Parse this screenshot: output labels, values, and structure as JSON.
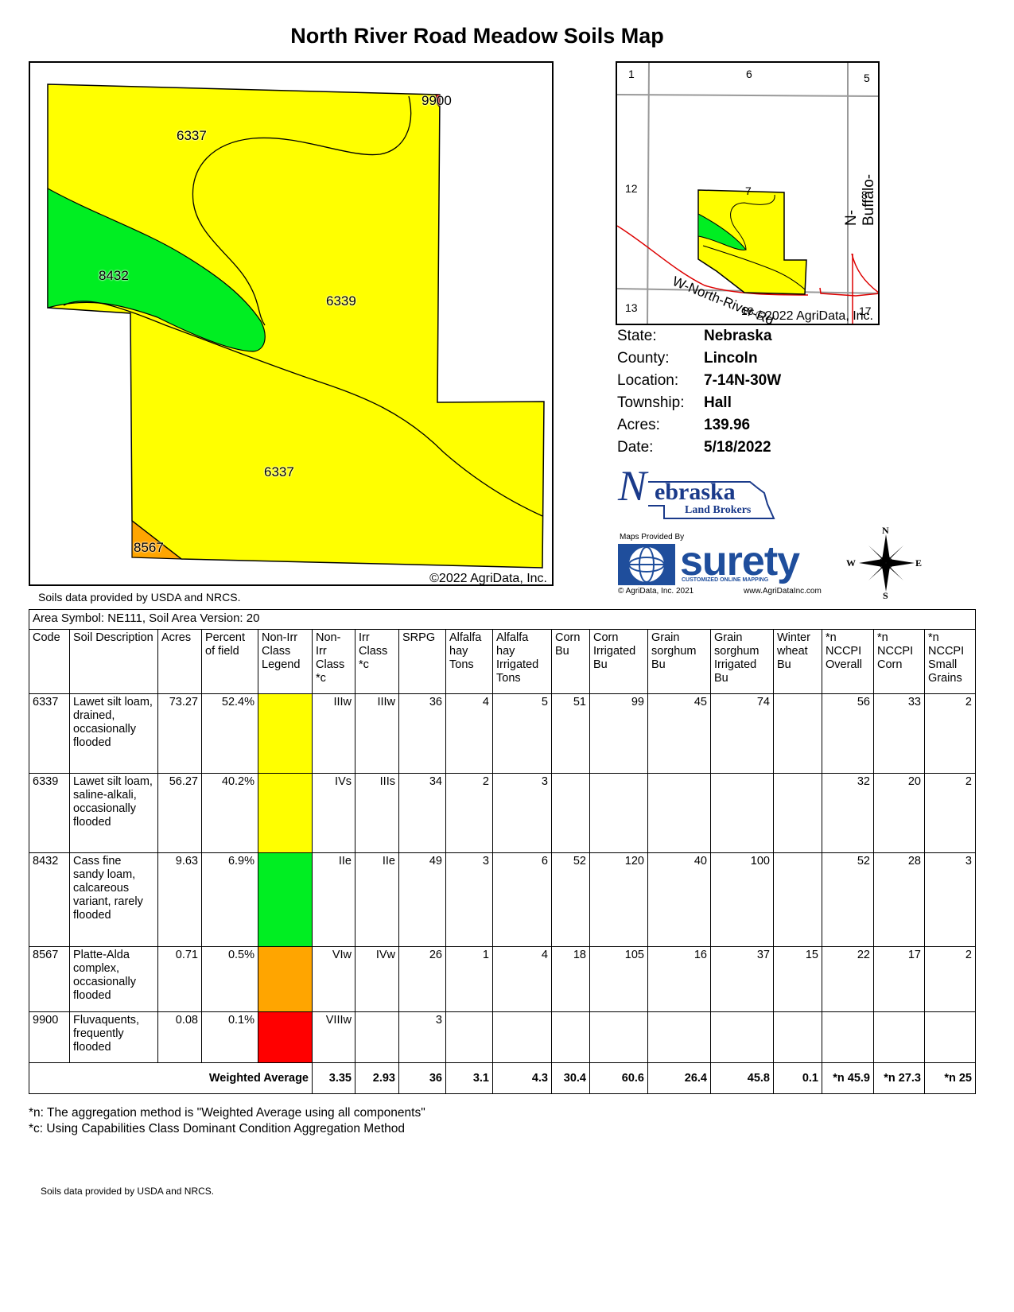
{
  "title": "North River Road Meadow Soils Map",
  "main_map": {
    "labels": [
      "6337",
      "9900",
      "8432",
      "6339",
      "6337",
      "8567"
    ],
    "copyright": "©2022 AgriData, Inc.",
    "colors": {
      "yellow": "#ffff00",
      "green": "#00ee22",
      "orange": "#ffa500"
    }
  },
  "attribution_top": "Soils data provided by USDA and NRCS.",
  "locator_map": {
    "sections": [
      "1",
      "6",
      "5",
      "12",
      "7",
      "8",
      "13",
      "18",
      "17"
    ],
    "roads": [
      "N-Buffalo-Rd",
      "W-North-River-Rd"
    ],
    "copyright": "©2022 AgriData, Inc."
  },
  "info": [
    {
      "label": "State:",
      "value": "Nebraska"
    },
    {
      "label": "County:",
      "value": "Lincoln"
    },
    {
      "label": "Location:",
      "value": "7-14N-30W"
    },
    {
      "label": "Township:",
      "value": "Hall"
    },
    {
      "label": "Acres:",
      "value": "139.96"
    },
    {
      "label": "Date:",
      "value": "5/18/2022"
    }
  ],
  "logos": {
    "nlb_main": "ebraska",
    "nlb_initial": "N",
    "nlb_sub": "Land Brokers",
    "surety_top": "Maps Provided By",
    "surety_name": "surety",
    "surety_tag": "CUSTOMIZED ONLINE MAPPING",
    "surety_copy": "© AgriData, Inc. 2021",
    "surety_url": "www.AgriDataInc.com",
    "compass": {
      "n": "N",
      "s": "S",
      "e": "E",
      "w": "W"
    }
  },
  "table": {
    "area": "Area Symbol: NE111, Soil Area Version: 20",
    "headers": [
      "Code",
      "Soil Description",
      "Acres",
      "Percent of field",
      "Non-Irr Class Legend",
      "Non-Irr Class *c",
      "Irr Class *c",
      "SRPG",
      "Alfalfa hay Tons",
      "Alfalfa hay Irrigated Tons",
      "Corn Bu",
      "Corn Irrigated Bu",
      "Grain sorghum Bu",
      "Grain sorghum Irrigated Bu",
      "Winter wheat Bu",
      "*n NCCPI Overall",
      "*n NCCPI Corn",
      "*n NCCPI Small Grains"
    ],
    "rows": [
      {
        "code": "6337",
        "desc": "Lawet silt loam, drained, occasionally flooded",
        "acres": "73.27",
        "pct": "52.4%",
        "color": "#ffff00",
        "nonirr": "IIIw",
        "irr": "IIIw",
        "srpg": "36",
        "alf": "4",
        "alfi": "5",
        "corn": "51",
        "corni": "99",
        "gs": "45",
        "gsi": "74",
        "ww": "",
        "n1": "56",
        "n2": "33",
        "n3": "2"
      },
      {
        "code": "6339",
        "desc": "Lawet silt loam, saline-alkali, occasionally flooded",
        "acres": "56.27",
        "pct": "40.2%",
        "color": "#ffff00",
        "nonirr": "IVs",
        "irr": "IIIs",
        "srpg": "34",
        "alf": "2",
        "alfi": "3",
        "corn": "",
        "corni": "",
        "gs": "",
        "gsi": "",
        "ww": "",
        "n1": "32",
        "n2": "20",
        "n3": "2"
      },
      {
        "code": "8432",
        "desc": "Cass fine sandy loam, calcareous variant, rarely flooded",
        "acres": "9.63",
        "pct": "6.9%",
        "color": "#00ee22",
        "nonirr": "IIe",
        "irr": "IIe",
        "srpg": "49",
        "alf": "3",
        "alfi": "6",
        "corn": "52",
        "corni": "120",
        "gs": "40",
        "gsi": "100",
        "ww": "",
        "n1": "52",
        "n2": "28",
        "n3": "3"
      },
      {
        "code": "8567",
        "desc": "Platte-Alda complex, occasionally flooded",
        "acres": "0.71",
        "pct": "0.5%",
        "color": "#ffa500",
        "nonirr": "VIw",
        "irr": "IVw",
        "srpg": "26",
        "alf": "1",
        "alfi": "4",
        "corn": "18",
        "corni": "105",
        "gs": "16",
        "gsi": "37",
        "ww": "15",
        "n1": "22",
        "n2": "17",
        "n3": "2"
      },
      {
        "code": "9900",
        "desc": "Fluvaquents, frequently flooded",
        "acres": "0.08",
        "pct": "0.1%",
        "color": "#ff0000",
        "nonirr": "VIIIw",
        "irr": "",
        "srpg": "3",
        "alf": "",
        "alfi": "",
        "corn": "",
        "corni": "",
        "gs": "",
        "gsi": "",
        "ww": "",
        "n1": "",
        "n2": "",
        "n3": ""
      }
    ],
    "weighted": {
      "label": "Weighted Average",
      "nonirr": "3.35",
      "irr": "2.93",
      "srpg": "36",
      "alf": "3.1",
      "alfi": "4.3",
      "corn": "30.4",
      "corni": "60.6",
      "gs": "26.4",
      "gsi": "45.8",
      "ww": "0.1",
      "n1": "*n 45.9",
      "n2": "*n 27.3",
      "n3": "*n 25"
    }
  },
  "notes": [
    "*n: The aggregation method is \"Weighted Average using all components\"",
    "*c:  Using Capabilities Class Dominant Condition Aggregation Method"
  ],
  "attribution_bottom": "Soils data provided by USDA and NRCS."
}
